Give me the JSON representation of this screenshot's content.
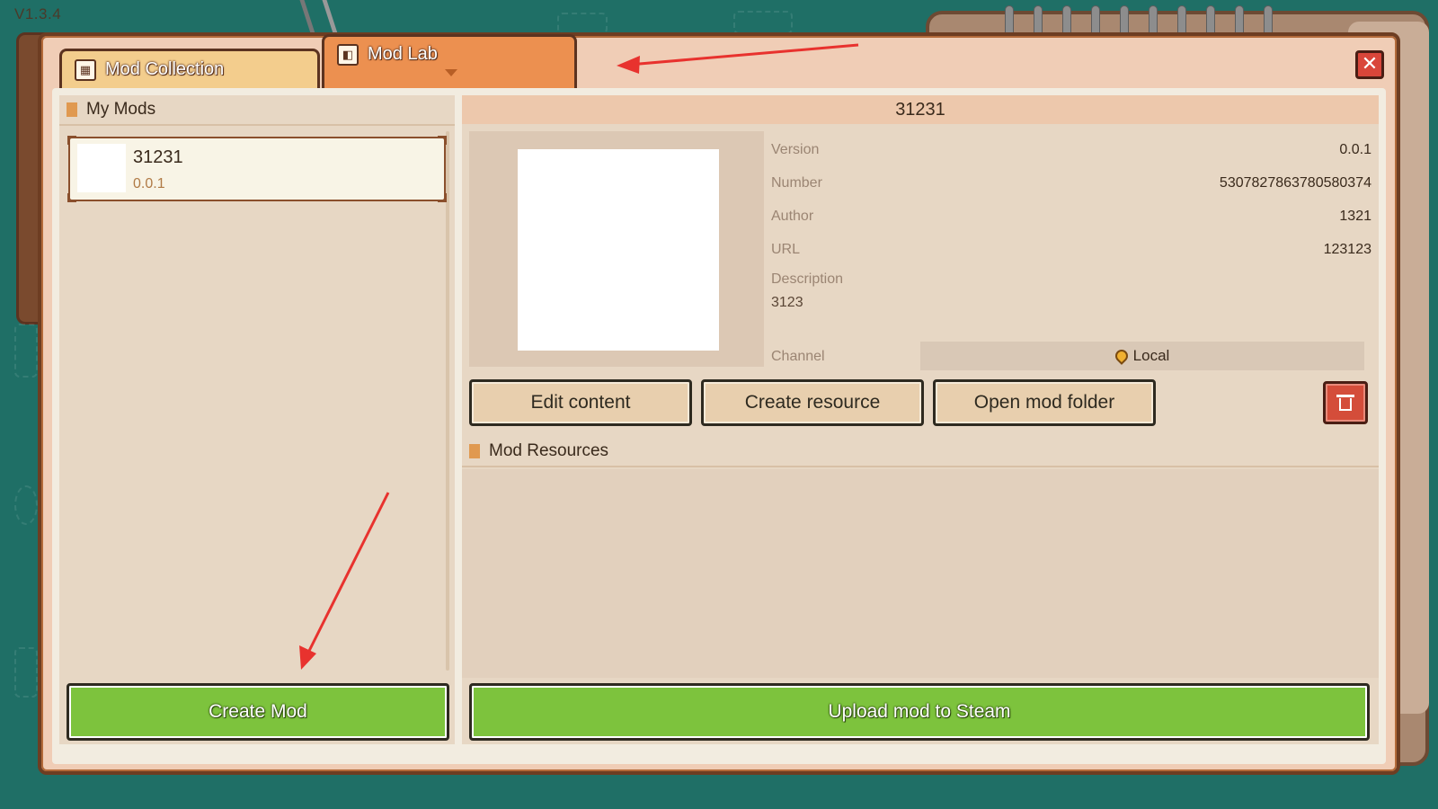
{
  "app": {
    "version": "V1.3.4"
  },
  "tabs": [
    {
      "label": "Mod Collection",
      "icon": "calendar-icon",
      "active": false
    },
    {
      "label": "Mod Lab",
      "icon": "puzzle-icon",
      "active": true
    }
  ],
  "close_icon": "close-icon",
  "my_mods": {
    "header": "My Mods",
    "items": [
      {
        "name": "31231",
        "version": "0.0.1",
        "selected": true
      }
    ],
    "create_button": "Create Mod"
  },
  "detail": {
    "title": "31231",
    "fields": [
      {
        "label": "Version",
        "value": "0.0.1"
      },
      {
        "label": "Number",
        "value": "5307827863780580374"
      },
      {
        "label": "Author",
        "value": "1321"
      },
      {
        "label": "URL",
        "value": "123123"
      }
    ],
    "description_label": "Description",
    "description_value": "3123",
    "channel_label": "Channel",
    "channel_value": "Local",
    "channel_icon": "location-pin-icon",
    "buttons": {
      "edit": "Edit content",
      "create_resource": "Create resource",
      "open_folder": "Open mod folder"
    },
    "delete_icon": "trash-icon",
    "resources_header": "Mod Resources",
    "upload_button": "Upload mod to Steam"
  },
  "colors": {
    "accent_green": "#7dc33d",
    "tab_active": "#ec9050",
    "tab_inactive": "#f3cd8d",
    "delete_red": "#d44d3a",
    "annotation_arrow": "#e8322e"
  }
}
